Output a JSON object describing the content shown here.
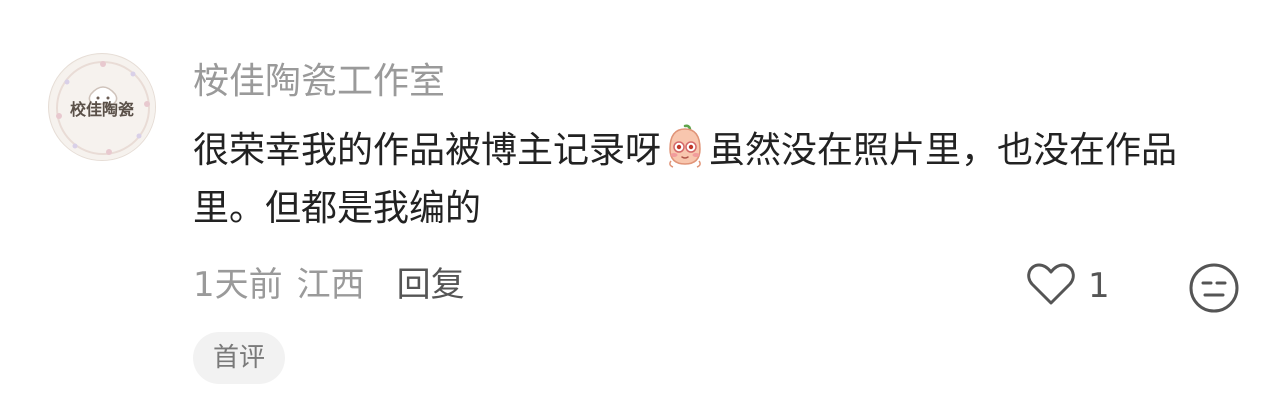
{
  "comment": {
    "avatar_text": "校佳陶瓷",
    "username": "桉佳陶瓷工作室",
    "content_before_emoji": "很荣幸我的作品被博主记录呀",
    "emoji_icon": "blushing-face-sticker",
    "content_after_emoji": "虽然没在照片里，也没在作品里。但都是我编的",
    "time": "1天前",
    "location": "江西",
    "reply_label": "回复",
    "like_count": "1",
    "badge": "首评"
  }
}
